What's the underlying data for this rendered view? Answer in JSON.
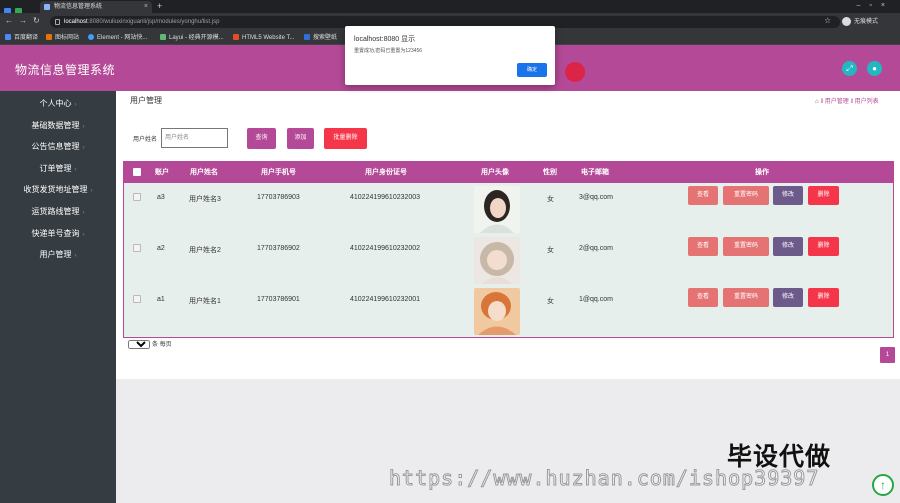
{
  "browser": {
    "tab_title": "物流信息管理系统",
    "tab_close": "×",
    "new_tab": "+",
    "url_host": "localhost",
    "url_rest": ":8080/wuliuxinxiguanli/jsp/modules/yonghu/list.jsp",
    "incognito_label": "无痕模式",
    "bookmarks": [
      "百度翻译",
      "图标网站",
      "Element - 网站快...",
      "Layui - 经典开源模...",
      "HTML5 Website T...",
      "搜索壁纸"
    ]
  },
  "app": {
    "title": "物流信息管理系统"
  },
  "sidebar": {
    "items": [
      {
        "label": "个人中心",
        "chevron": "›"
      },
      {
        "label": "基础数据管理",
        "chevron": "›"
      },
      {
        "label": "公告信息管理",
        "chevron": "›"
      },
      {
        "label": "订单管理",
        "chevron": "›"
      },
      {
        "label": "收货发货地址管理",
        "chevron": "›"
      },
      {
        "label": "运货路线管理",
        "chevron": "›"
      },
      {
        "label": "快递单号查询",
        "chevron": "›"
      },
      {
        "label": "用户管理",
        "chevron": "›"
      }
    ]
  },
  "page": {
    "title": "用户管理",
    "breadcrumb": "‖ 用户管理 ‖ 用户列表"
  },
  "search": {
    "label": "用户姓名",
    "placeholder": "用户姓名",
    "query_button": "查询",
    "add_button": "添加",
    "batch_delete_button": "批量删除"
  },
  "table": {
    "headers": [
      "账户",
      "用户姓名",
      "用户手机号",
      "用户身份证号",
      "用户头像",
      "性别",
      "电子邮箱",
      "操作"
    ],
    "rows": [
      {
        "account": "a3",
        "name": "用户姓名3",
        "phone": "17703786903",
        "id_card": "410224199610232003",
        "gender": "女",
        "email": "3@qq.com"
      },
      {
        "account": "a2",
        "name": "用户姓名2",
        "phone": "17703786902",
        "id_card": "410224199610232002",
        "gender": "女",
        "email": "2@qq.com"
      },
      {
        "account": "a1",
        "name": "用户姓名1",
        "phone": "17703786901",
        "id_card": "410224199610232001",
        "gender": "女",
        "email": "1@qq.com"
      }
    ],
    "actions": {
      "view": "查看",
      "reset_password": "重置密码",
      "edit": "修改",
      "delete": "删除"
    }
  },
  "pagination": {
    "page_size": "10",
    "per_page_label": "条 每页",
    "current_page": "1"
  },
  "dialog": {
    "title": "localhost:8080 显示",
    "message": "重置成功,密码已重置为123456",
    "ok_button": "确定"
  },
  "watermark": {
    "text": "毕设代做",
    "url": "https://www.huzhan.com/ishop39397"
  },
  "colors": {
    "brand": "#b44a97",
    "sidebar": "#363d42",
    "view_btn": "#e57373",
    "reset_btn": "#e57373",
    "edit_btn": "#6b5a8a",
    "delete_btn": "#f5364a",
    "batch_delete_btn": "#f5364a"
  }
}
